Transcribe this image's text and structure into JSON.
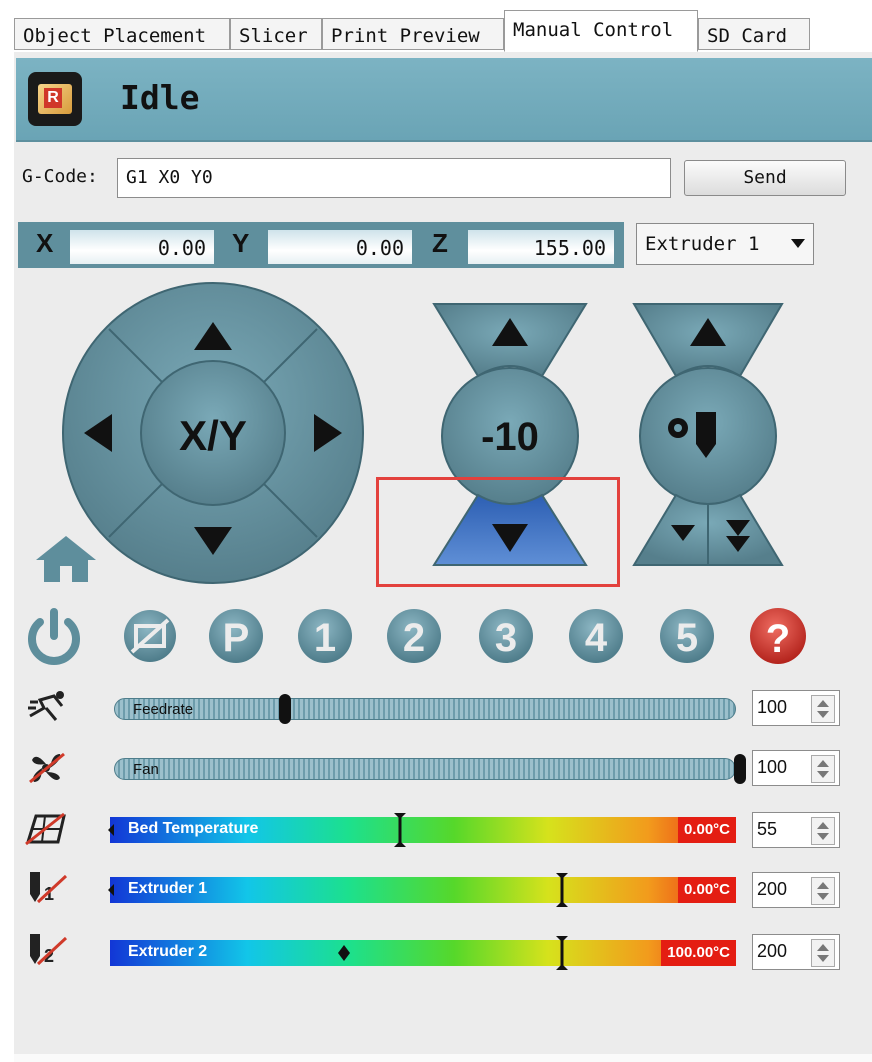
{
  "tabs": [
    {
      "label": "Object Placement",
      "active": false
    },
    {
      "label": "Slicer",
      "active": false
    },
    {
      "label": "Print Preview",
      "active": false
    },
    {
      "label": "Manual Control",
      "active": true
    },
    {
      "label": "SD Card",
      "active": false
    }
  ],
  "status": {
    "text": "Idle",
    "icon": "repetier-logo-icon"
  },
  "gcode": {
    "label": "G-Code:",
    "value": "G1 X0 Y0",
    "send_label": "Send"
  },
  "coords": {
    "x_label": "X",
    "x_value": "0.00",
    "y_label": "Y",
    "y_value": "0.00",
    "z_label": "Z",
    "z_value": "155.00"
  },
  "extruder_select": {
    "value": "Extruder 1"
  },
  "jog": {
    "xy_label": "X/Y",
    "z_step_label": "-10",
    "home_icon": "home-icon",
    "extruder_icon": "extruder-gear-icon"
  },
  "icon_row": [
    {
      "name": "power-icon"
    },
    {
      "name": "no-motors-icon"
    },
    {
      "name": "park-icon",
      "glyph": "P"
    },
    {
      "name": "preset-1-icon",
      "glyph": "1"
    },
    {
      "name": "preset-2-icon",
      "glyph": "2"
    },
    {
      "name": "preset-3-icon",
      "glyph": "3"
    },
    {
      "name": "preset-4-icon",
      "glyph": "4"
    },
    {
      "name": "preset-5-icon",
      "glyph": "5"
    },
    {
      "name": "help-icon",
      "glyph": "?"
    }
  ],
  "sliders": {
    "feedrate": {
      "label": "Feedrate",
      "value": "100",
      "level": 0.27,
      "icon": "runner-icon"
    },
    "fan": {
      "label": "Fan",
      "value": "100",
      "level": 1.0,
      "icon": "fan-off-icon"
    },
    "bed": {
      "label": "Bed Temperature",
      "reading": "0.00°C",
      "target": "55",
      "icon": "bed-off-icon"
    },
    "extruder1": {
      "label": "Extruder 1",
      "reading": "0.00°C",
      "target": "200",
      "icon": "extruder1-off-icon"
    },
    "extruder2": {
      "label": "Extruder 2",
      "reading": "100.00°C",
      "target": "200",
      "icon": "extruder2-off-icon"
    }
  },
  "colors": {
    "accent": "#6aa4b5",
    "button": "#5e8e9c",
    "highlight": "#e3413d",
    "active_button": "#3d6fbf"
  }
}
